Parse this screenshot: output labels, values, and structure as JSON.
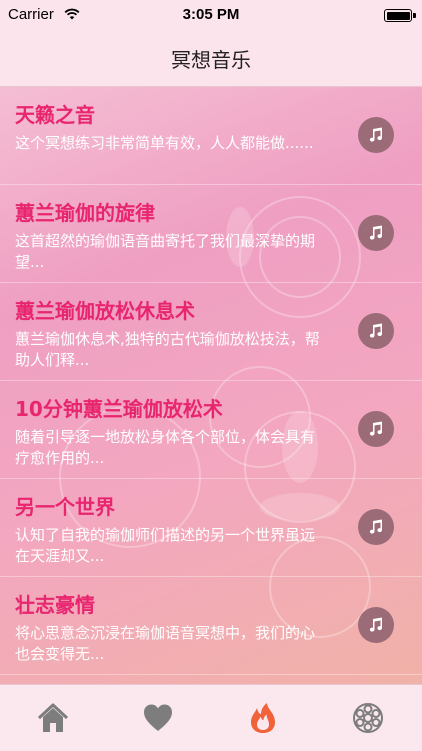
{
  "status_bar": {
    "carrier": "Carrier",
    "time": "3:05 PM"
  },
  "nav": {
    "title": "冥想音乐"
  },
  "list": [
    {
      "title": "天籁之音",
      "desc": "这个冥想练习非常简单有效，人人都能做......"
    },
    {
      "title": "蕙兰瑜伽的旋律",
      "desc": "这首超然的瑜伽语音曲寄托了我们最深挚的期望..."
    },
    {
      "title": "蕙兰瑜伽放松休息术",
      "desc": "蕙兰瑜伽休息术,独特的古代瑜伽放松技法，帮助人们释..."
    },
    {
      "title": "10分钟蕙兰瑜伽放松术",
      "desc": "随着引导逐一地放松身体各个部位，体会具有疗愈作用的..."
    },
    {
      "title": "另一个世界",
      "desc": "认知了自我的瑜伽师们描述的另一个世界虽远在天涯却又..."
    },
    {
      "title": "壮志豪情",
      "desc": "将心思意念沉浸在瑜伽语音冥想中，我们的心也会变得无..."
    }
  ],
  "tabs": [
    {
      "icon": "home-icon",
      "active": false
    },
    {
      "icon": "heart-icon",
      "active": false
    },
    {
      "icon": "flame-icon",
      "active": true
    },
    {
      "icon": "lotus-icon",
      "active": false
    }
  ],
  "colors": {
    "title": "#e8256f",
    "active_tab": "#f0623a",
    "inactive_tab": "#808080"
  }
}
